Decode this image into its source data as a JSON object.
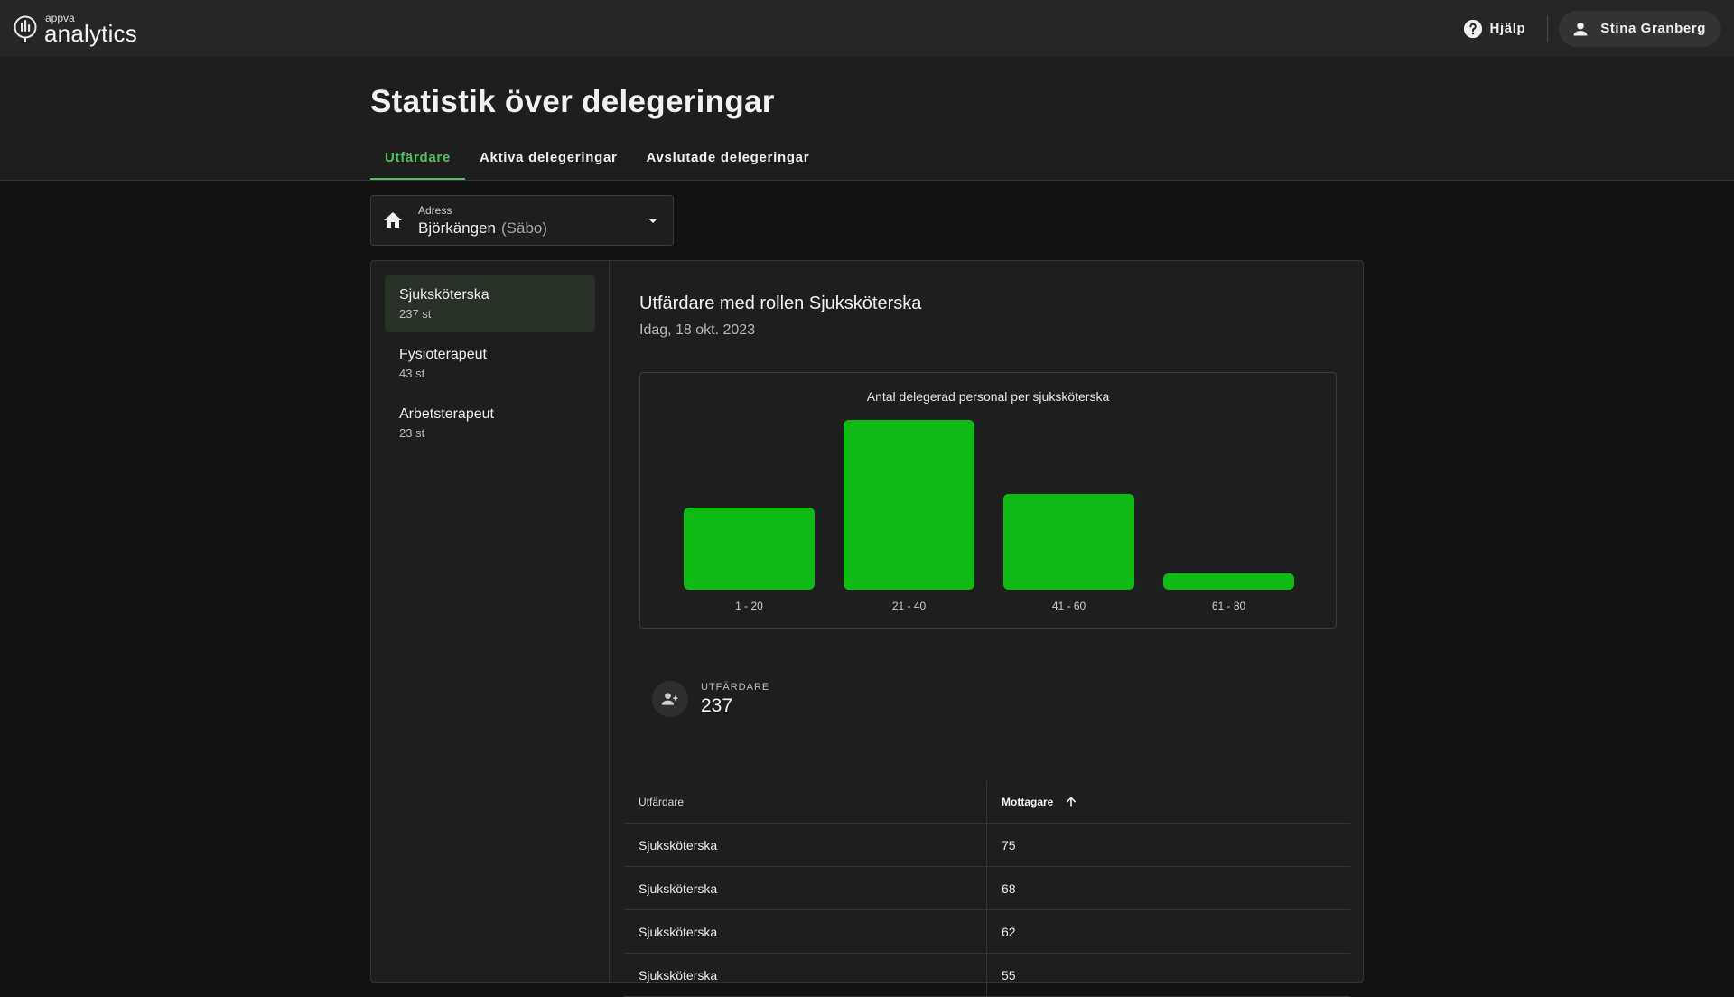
{
  "app": {
    "logo_small": "appva",
    "logo_big": "analytics"
  },
  "topbar": {
    "help_label": "Hjälp",
    "user_name": "Stina Granberg"
  },
  "page": {
    "title": "Statistik över delegeringar"
  },
  "tabs": [
    {
      "label": "Utfärdare",
      "active": true
    },
    {
      "label": "Aktiva delegeringar",
      "active": false
    },
    {
      "label": "Avslutade delegeringar",
      "active": false
    }
  ],
  "address": {
    "label": "Adress",
    "value": "Björkängen",
    "sub": "(Säbo)"
  },
  "roles": [
    {
      "name": "Sjuksköterska",
      "count": "237 st",
      "selected": true
    },
    {
      "name": "Fysioterapeut",
      "count": "43 st",
      "selected": false
    },
    {
      "name": "Arbetsterapeut",
      "count": "23 st",
      "selected": false
    }
  ],
  "content": {
    "title": "Utfärdare med rollen Sjuksköterska",
    "date": "Idag, 18 okt. 2023"
  },
  "chart_data": {
    "type": "bar",
    "title": "Antal delegerad personal per sjuksköterska",
    "categories": [
      "1 - 20",
      "21 - 40",
      "41 - 60",
      "61 - 80"
    ],
    "values": [
      60,
      124,
      70,
      12
    ],
    "ylim": [
      0,
      124
    ],
    "grid": false,
    "color": "#0fba14",
    "xlabel": "",
    "ylabel": ""
  },
  "stat": {
    "label": "UTFÄRDARE",
    "value": "237"
  },
  "table": {
    "headers": [
      "Utfärdare",
      "Mottagare"
    ],
    "rows": [
      [
        "Sjuksköterska",
        "75"
      ],
      [
        "Sjuksköterska",
        "68"
      ],
      [
        "Sjuksköterska",
        "62"
      ],
      [
        "Sjuksköterska",
        "55"
      ]
    ]
  }
}
